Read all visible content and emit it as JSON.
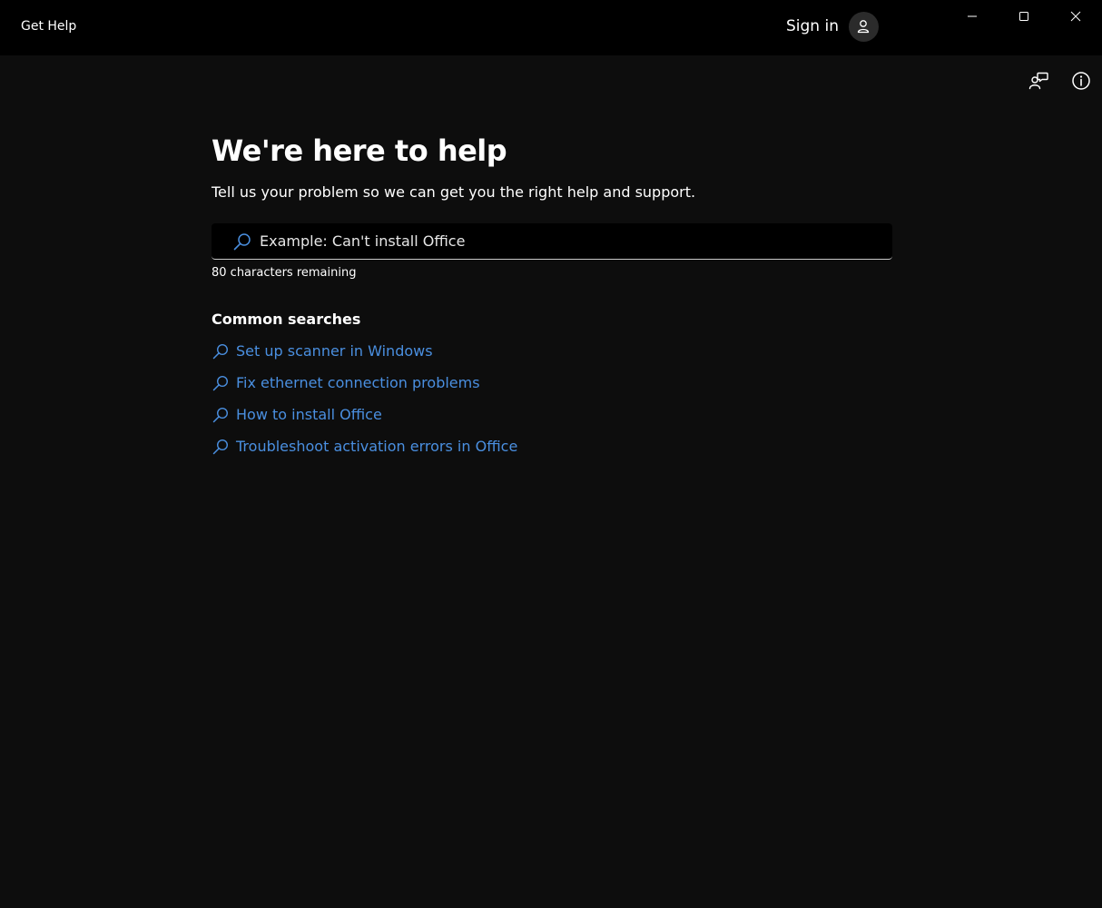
{
  "window": {
    "title": "Get Help",
    "controls": {
      "minimize_icon": "minimize-icon",
      "maximize_icon": "maximize-icon",
      "close_icon": "close-icon"
    }
  },
  "header": {
    "sign_in_label": "Sign in",
    "avatar_icon": "person-icon"
  },
  "toolbar": {
    "feedback_icon": "feedback-icon",
    "info_icon": "info-icon"
  },
  "main": {
    "heading": "We're here to help",
    "subheading": "Tell us your problem so we can get you the right help and support.",
    "search": {
      "placeholder": "Example: Can't install Office",
      "value": "",
      "icon": "search-icon"
    },
    "char_count": "80 characters remaining",
    "common_searches": {
      "title": "Common searches",
      "items": [
        {
          "label": "Set up scanner in Windows",
          "icon": "search-icon"
        },
        {
          "label": "Fix ethernet connection problems",
          "icon": "search-icon"
        },
        {
          "label": "How to install Office",
          "icon": "search-icon"
        },
        {
          "label": "Troubleshoot activation errors in Office",
          "icon": "search-icon"
        }
      ]
    }
  },
  "colors": {
    "background": "#0d0d0d",
    "titlebar": "#000000",
    "link": "#4a8fe0",
    "text": "#ffffff"
  }
}
